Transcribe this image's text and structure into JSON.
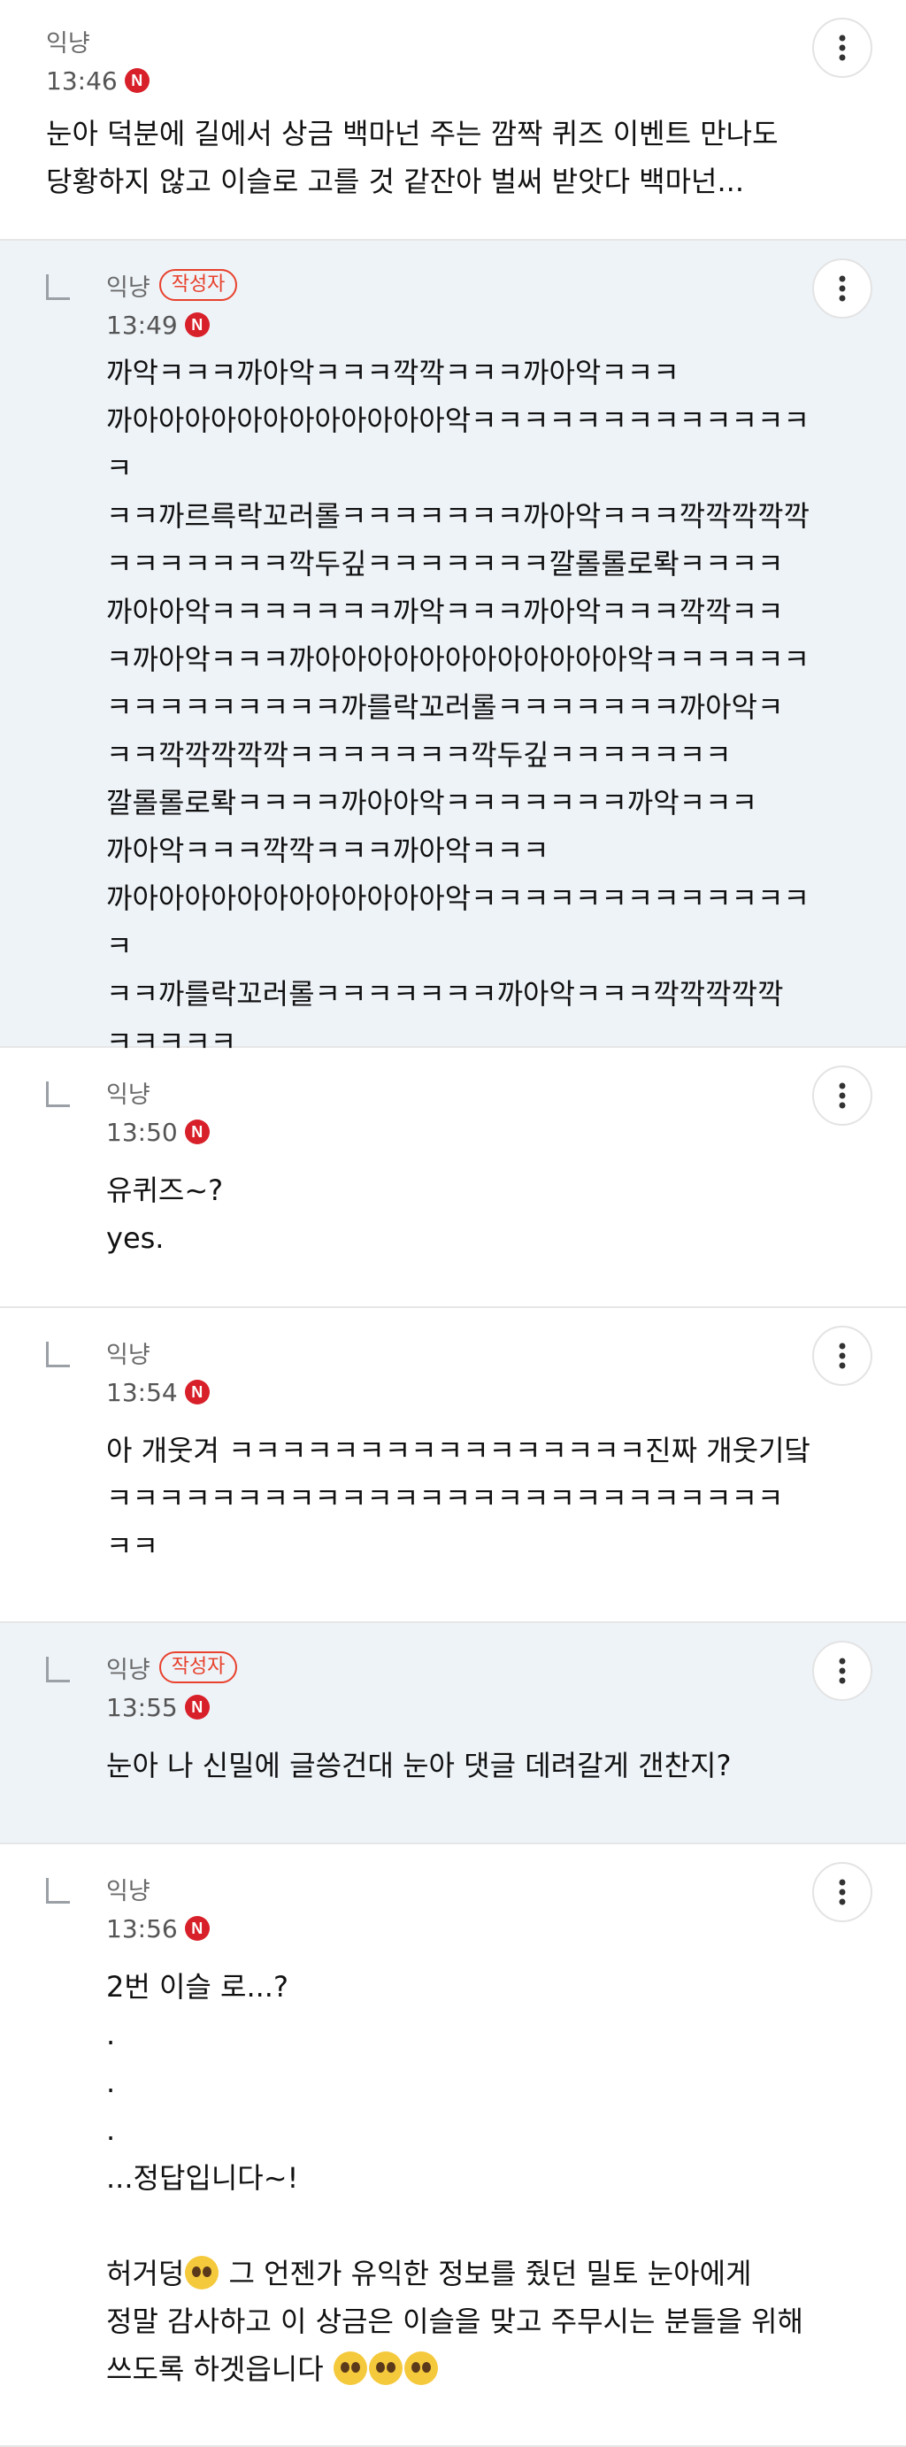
{
  "comments": [
    {
      "nickname": "익냥",
      "time": "13:46",
      "badge": "N",
      "text": "눈아 덕분에 길에서 상금 백마넌 주는 깜짝 퀴즈 이벤트 만나도\n당황하지 않고 이슬로 고를 것 같잔아 벌써 받앗다 백마넌..."
    },
    {
      "nickname": "익냥",
      "author_label": "작성자",
      "time": "13:49",
      "badge": "N",
      "text": "까악ㅋㅋㅋ까아악ㅋㅋㅋ깍깍ㅋㅋㅋ까아악ㅋㅋㅋ\n까아아아아아아아아아아아아악ㅋㅋㅋㅋㅋㅋㅋㅋㅋㅋㅋㅋㅋㅋ\nㅋㅋ까르륵락꼬러롤ㅋㅋㅋㅋㅋㅋㅋ까아악ㅋㅋㅋ깍깍깍깍깍\nㅋㅋㅋㅋㅋㅋㅋ깍두깊ㅋㅋㅋㅋㅋㅋㅋ깔롤롤로롹ㅋㅋㅋㅋ\n까아아악ㅋㅋㅋㅋㅋㅋㅋ까악ㅋㅋㅋ까아악ㅋㅋㅋ깍깍ㅋㅋ\nㅋ까아악ㅋㅋㅋ까아아아아아아아아아아아아악ㅋㅋㅋㅋㅋㅋ\nㅋㅋㅋㅋㅋㅋㅋㅋㅋ까를락꼬러롤ㅋㅋㅋㅋㅋㅋㅋ까아악ㅋ\nㅋㅋ깍깍깍깍깍ㅋㅋㅋㅋㅋㅋㅋ깍두깊ㅋㅋㅋㅋㅋㅋㅋ\n깔롤롤로롹ㅋㅋㅋㅋ까아아악ㅋㅋㅋㅋㅋㅋㅋ까악ㅋㅋㅋ\n까아악ㅋㅋㅋ깍깍ㅋㅋㅋ까아악ㅋㅋㅋ\n까아아아아아아아아아아아아악ㅋㅋㅋㅋㅋㅋㅋㅋㅋㅋㅋㅋㅋㅋ\nㅋㅋ까를락꼬러롤ㅋㅋㅋㅋㅋㅋㅋ까아악ㅋㅋㅋ깍깍깍깍깍\nㅋㅋㅋㅋㅋ"
    },
    {
      "nickname": "익냥",
      "time": "13:50",
      "badge": "N",
      "text": "유퀴즈~?\nyes."
    },
    {
      "nickname": "익냥",
      "time": "13:54",
      "badge": "N",
      "text": "아 개웃겨 ㅋㅋㅋㅋㅋㅋㅋㅋㅋㅋㅋㅋㅋㅋㅋㅋ진짜 개웃기닼\nㅋㅋㅋㅋㅋㅋㅋㅋㅋㅋㅋㅋㅋㅋㅋㅋㅋㅋㅋㅋㅋㅋㅋㅋㅋㅋ\nㅋㅋ"
    },
    {
      "nickname": "익냥",
      "author_label": "작성자",
      "time": "13:55",
      "badge": "N",
      "text": "눈아 나 신밀에 글씅건대 눈아 댓글 데려갈게 갠찬지?"
    },
    {
      "nickname": "익냥",
      "time": "13:56",
      "badge": "N",
      "text_a": "2번 이슬 로...?\n.\n.\n.\n...정답입니다~!\n\n허거덩",
      "text_b": " 그 언젠가 유익한 정보를 줬던 밀토 눈아에게\n정말 감사하고 이 상금은 이슬을 맞고 주무시는 분들을 위해\n쓰도록 하겟읍니다 ",
      "emoji_names": [
        "flushed-face-icon",
        "pleading-face-icon"
      ]
    }
  ],
  "colors": {
    "author_bg": "#eef3f8",
    "badge_red": "#d8202a",
    "author_label": "#e8412c"
  }
}
